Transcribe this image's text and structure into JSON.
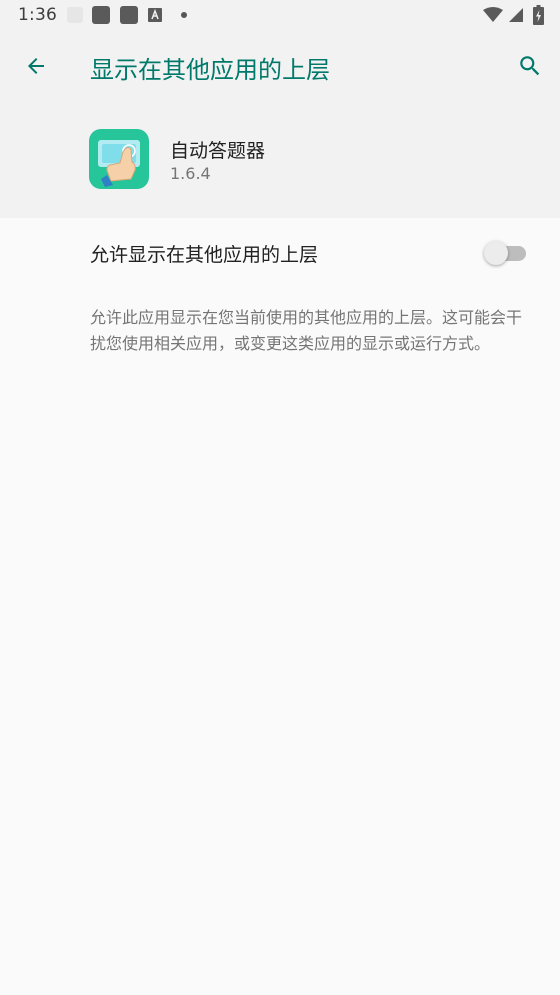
{
  "status_bar": {
    "time": "1:36",
    "notifications": [
      "ghost-notification-icon",
      "notification-icon",
      "notification-icon",
      "a-notification-icon",
      "more-notifications-dot"
    ],
    "system_icons": [
      "wifi-icon",
      "cell-signal-icon",
      "battery-charging-icon"
    ]
  },
  "app_bar": {
    "title": "显示在其他应用的上层",
    "back_icon": "arrow-back-icon",
    "search_icon": "search-icon"
  },
  "app_info": {
    "name": "自动答题器",
    "version": "1.6.4",
    "icon": "tap-hand-app-icon"
  },
  "setting": {
    "label": "允许显示在其他应用的上层",
    "enabled": false
  },
  "description": "允许此应用显示在您当前使用的其他应用的上层。这可能会干扰您使用相关应用，或变更这类应用的显示或运行方式。",
  "colors": {
    "accent": "#00796b",
    "app_bar_background": "#f2f2f2",
    "page_background": "#fafafa",
    "app_icon_background": "#26c59a"
  }
}
